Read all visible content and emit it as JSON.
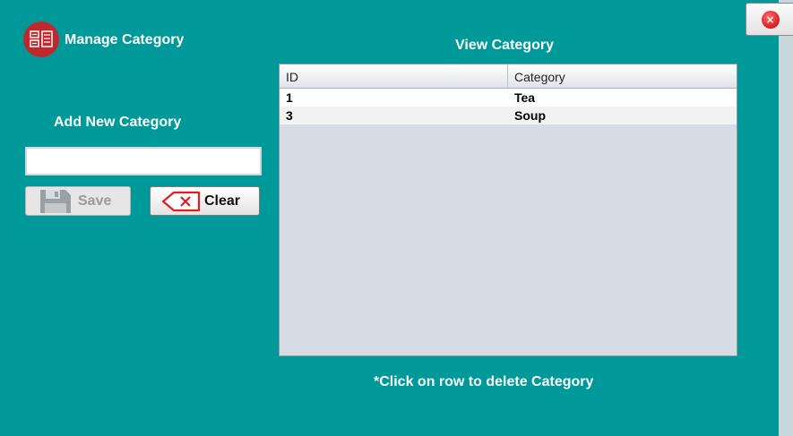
{
  "app": {
    "title": "Manage Category",
    "logo_icon": "category-list-icon",
    "close_icon": "close-icon",
    "close_glyph": "×"
  },
  "form": {
    "title": "Add New Category",
    "input_value": "",
    "input_placeholder": "",
    "save_label": "Save",
    "clear_label": "Clear",
    "save_icon": "floppy-disk-icon",
    "clear_icon": "backspace-x-icon"
  },
  "view": {
    "title": "View Category",
    "columns": [
      "ID",
      "Category"
    ],
    "rows": [
      {
        "id": "1",
        "category": "Tea"
      },
      {
        "id": "3",
        "category": "Soup"
      }
    ],
    "hint": "*Click on row to delete Category"
  },
  "colors": {
    "background": "#009999",
    "logo": "#c0282e",
    "close": "#d81f1f",
    "clear_icon": "#e02020"
  }
}
